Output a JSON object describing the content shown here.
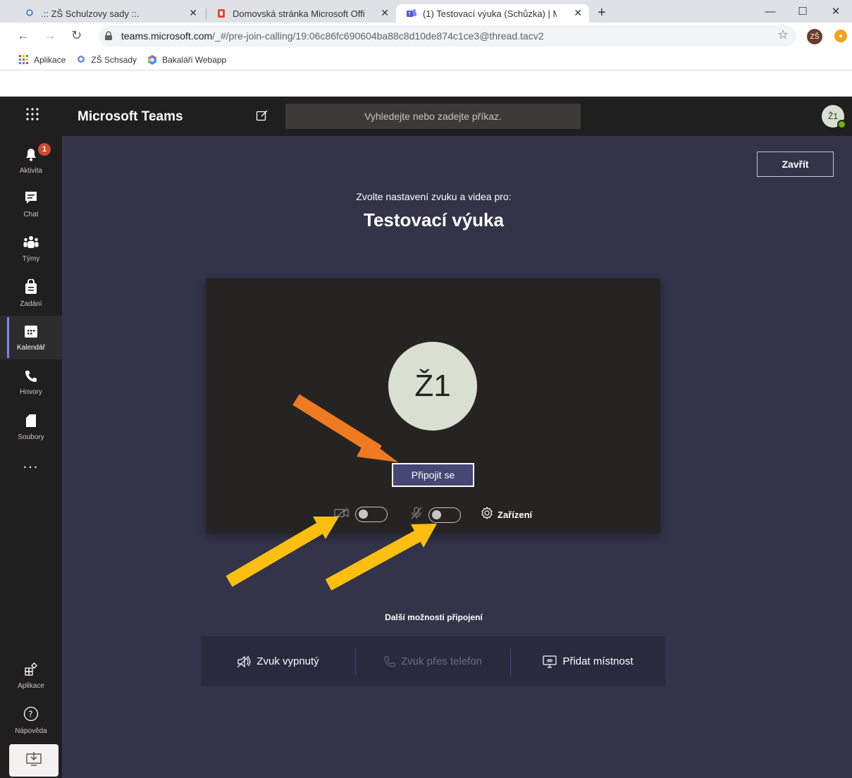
{
  "browser": {
    "tabs": [
      {
        "title": ".:: ZŠ Schulzovy sady ::.",
        "favicon": "school-icon"
      },
      {
        "title": "Domovská stránka Microsoft Offi",
        "favicon": "office-icon"
      },
      {
        "title": "(1) Testovací výuka (Schůzka) | M",
        "favicon": "teams-icon"
      }
    ],
    "url_host": "teams.microsoft.com",
    "url_path": "/_#/pre-join-calling/19:06c86fc690604ba88c8d10de874c1ce3@thread.tacv2",
    "profile_initials": "ZŠ",
    "bookmarks": [
      "Aplikace",
      "ZŠ Schsady",
      "Bakaláři Webapp"
    ]
  },
  "teams": {
    "brand": "Microsoft Teams",
    "search_placeholder": "Vyhledejte nebo zadejte příkaz.",
    "user_initials": "Ž1",
    "rail": [
      {
        "label": "Aktivita",
        "icon": "bell-icon",
        "badge": "1"
      },
      {
        "label": "Chat",
        "icon": "chat-icon"
      },
      {
        "label": "Týmy",
        "icon": "teams-icon"
      },
      {
        "label": "Zadání",
        "icon": "assignments-icon"
      },
      {
        "label": "Kalendář",
        "icon": "calendar-icon"
      },
      {
        "label": "Hovory",
        "icon": "phone-icon"
      },
      {
        "label": "Soubory",
        "icon": "file-icon"
      },
      {
        "label": "...",
        "icon": "more-icon"
      },
      {
        "label": "Aplikace",
        "icon": "apps-icon"
      },
      {
        "label": "Nápověda",
        "icon": "help-icon"
      }
    ],
    "active_rail": "Kalendář"
  },
  "prejoin": {
    "close_label": "Zavřít",
    "subtitle": "Zvolte nastavení zvuku a videa pro:",
    "meeting_title": "Testovací výuka",
    "avatar_initials": "Ž1",
    "join_label": "Připojit se",
    "camera_on": false,
    "mic_on": false,
    "devices_label": "Zařízení",
    "more_options_title": "Další možnosti připojení",
    "options": [
      {
        "label": "Zvuk vypnutý",
        "icon": "speaker-off-icon",
        "enabled": true
      },
      {
        "label": "Zvuk přes telefon",
        "icon": "phone-icon",
        "enabled": false
      },
      {
        "label": "Přidat místnost",
        "icon": "room-icon",
        "enabled": true
      }
    ]
  },
  "colors": {
    "teams_bg": "#33344a",
    "rail_bg": "#201f1f",
    "accent": "#464775",
    "arrow_orange": "#f07a22",
    "arrow_yellow": "#fbbf12"
  }
}
